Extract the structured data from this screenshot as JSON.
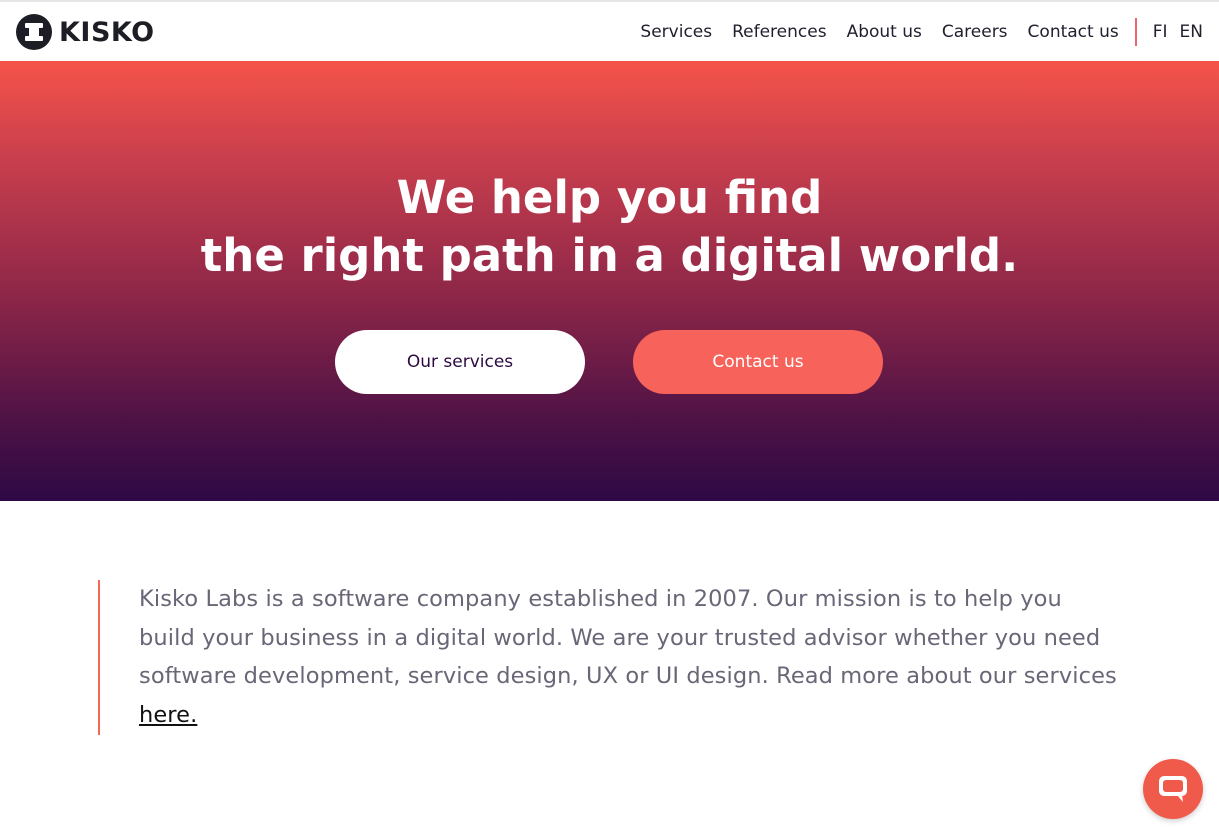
{
  "brand": {
    "name": "KISKO",
    "logo_icon": "kisko-logo-icon"
  },
  "nav": {
    "items": [
      {
        "label": "Services"
      },
      {
        "label": "References"
      },
      {
        "label": "About us"
      },
      {
        "label": "Careers"
      },
      {
        "label": "Contact us"
      }
    ],
    "languages": [
      {
        "label": "FI"
      },
      {
        "label": "EN"
      }
    ]
  },
  "hero": {
    "title_line1": "We help you find",
    "title_line2": "the right path in a digital world.",
    "primary_button": "Our services",
    "secondary_button": "Contact us"
  },
  "intro": {
    "text": "Kisko Labs is a software company established in 2007. Our mission is to help you build your business in a digital world. We are your trusted advisor whether you need software development, service design, UX or UI design. Read more about our services ",
    "link_text": "here."
  },
  "chat": {
    "icon": "chat-bubble-icon"
  },
  "colors": {
    "accent": "#f7635a",
    "hero_top": "#f55349",
    "hero_bottom": "#2e0945",
    "text_dark": "#1f1f2e",
    "body_text": "#6b6677",
    "divider": "#f2646a"
  }
}
